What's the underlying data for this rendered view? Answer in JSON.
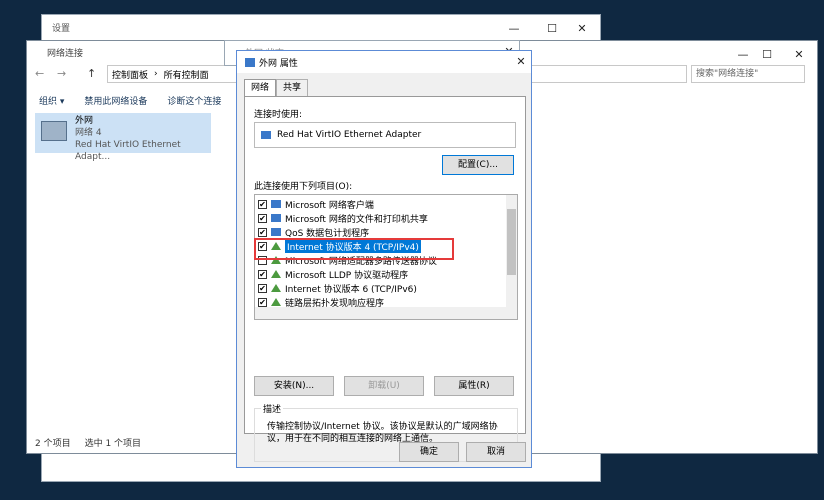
{
  "settings": {
    "title": "设置",
    "controls": [
      "—",
      "☐",
      "✕"
    ]
  },
  "netconn": {
    "title": "网络连接",
    "breadcrumb": [
      "控制面板",
      "所有控制面"
    ],
    "search_placeholder": "搜索\"网络连接\"",
    "controls": [
      "—",
      "☐",
      "✕"
    ],
    "commands": [
      "组织 ▾",
      "禁用此网络设备",
      "诊断这个连接"
    ],
    "adapter": {
      "name": "外网",
      "status": "网络 4",
      "device": "Red Hat VirtIO Ethernet Adapt..."
    },
    "status": {
      "count": "2 个项目",
      "selected": "选中 1 个项目"
    }
  },
  "midwin": {
    "title": "外网 状态",
    "close": "✕"
  },
  "dialog": {
    "title": "外网 属性",
    "close": "✕",
    "tabs": [
      "网络",
      "共享"
    ],
    "connect_using_label": "连接时使用:",
    "adapter_name": "Red Hat VirtIO Ethernet Adapter",
    "configure_button": "配置(C)...",
    "items_label": "此连接使用下列项目(O):",
    "items": [
      {
        "label": "Microsoft 网络客户端",
        "checked": "✔"
      },
      {
        "label": "Microsoft 网络的文件和打印机共享",
        "checked": "✔"
      },
      {
        "label": "QoS 数据包计划程序",
        "checked": "✔"
      },
      {
        "label": "Internet 协议版本 4 (TCP/IPv4)",
        "checked": "✔"
      },
      {
        "label": "Microsoft 网络适配器多路传送器协议",
        "checked": ""
      },
      {
        "label": "Microsoft LLDP 协议驱动程序",
        "checked": "✔"
      },
      {
        "label": "Internet 协议版本 6 (TCP/IPv6)",
        "checked": "✔"
      },
      {
        "label": "链路层拓扑发现响应程序",
        "checked": "✔"
      }
    ],
    "install_button": "安装(N)...",
    "uninstall_button": "卸载(U)",
    "properties_button": "属性(R)",
    "desc_label": "描述",
    "desc_text": "传输控制协议/Internet 协议。该协议是默认的广域网络协议，用于在不同的相互连接的网络上通信。",
    "ok_button": "确定",
    "cancel_button": "取消"
  }
}
